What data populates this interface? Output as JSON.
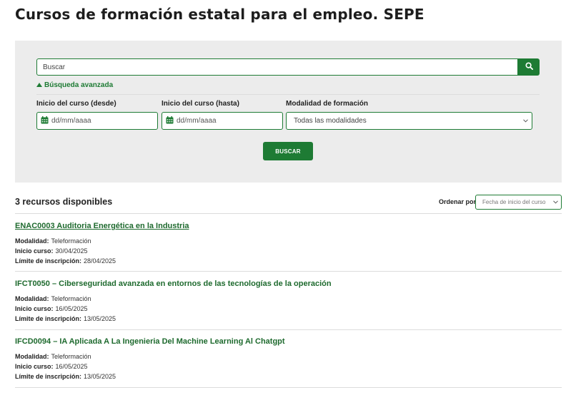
{
  "page": {
    "title": "Cursos de formación estatal para el empleo. SEPE"
  },
  "search": {
    "placeholder": "Buscar",
    "advanced_label": "Búsqueda avanzada",
    "fields": {
      "start_from_label": "Inicio del curso (desde)",
      "start_to_label": "Inicio del curso (hasta)",
      "modality_label": "Modalidad de formación",
      "date_placeholder": "dd/mm/aaaa",
      "modality_value": "Todas las modalidades"
    },
    "submit_label": "BUSCAR"
  },
  "results": {
    "count_label": "3 recursos disponibles",
    "order_label": "Ordenar por",
    "order_value": "Fecha de inicio del curso",
    "meta_labels": {
      "modality": "Modalidad:",
      "start": "Inicio curso:",
      "deadline": "Límite de inscripción:"
    },
    "courses": [
      {
        "title": "ENAC0003 Auditoria Energética en la Industria",
        "modality": "Teleformación",
        "start": "30/04/2025",
        "deadline": "28/04/2025"
      },
      {
        "title": "IFCT0050 – Ciberseguridad avanzada en entornos de las tecnologías de la operación",
        "modality": "Teleformación",
        "start": "16/05/2025",
        "deadline": "13/05/2025"
      },
      {
        "title": "IFCD0094 – IA Aplicada A La Ingenieria Del Machine Learning Al Chatgpt",
        "modality": "Teleformación",
        "start": "16/05/2025",
        "deadline": "13/05/2025"
      }
    ]
  },
  "colors": {
    "accent": "#1e7b34",
    "panel": "#ececec",
    "link": "#1e6a2e"
  }
}
